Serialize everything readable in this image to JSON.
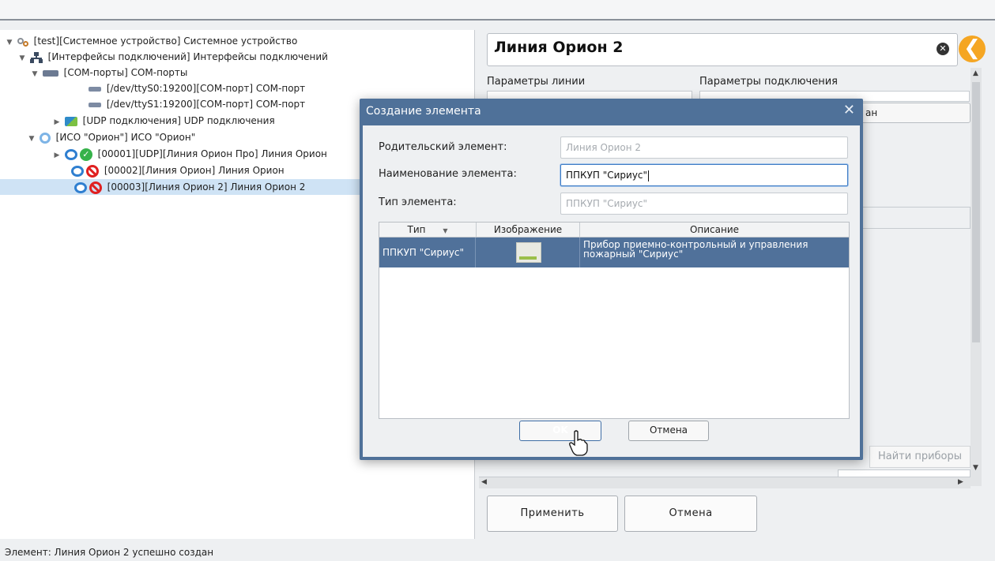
{
  "tree": {
    "items": [
      {
        "label": "[test][Системное устройство] Системное устройство"
      },
      {
        "label": "[Интерфейсы подключений] Интерфейсы подключений"
      },
      {
        "label": "[COM-порты] COM-порты"
      },
      {
        "label": "[/dev/ttyS0:19200][COM-порт] COM-порт"
      },
      {
        "label": "[/dev/ttyS1:19200][COM-порт] COM-порт"
      },
      {
        "label": "[UDP подключения] UDP подключения"
      },
      {
        "label": "[ИСО \"Орион\"] ИСО \"Орион\""
      },
      {
        "label": "[00001][UDP][Линия Орион Про] Линия Орион"
      },
      {
        "label": "[00002][Линия Орион] Линия Орион"
      },
      {
        "label": "[00003][Линия Орион 2] Линия Орион 2"
      }
    ]
  },
  "status": {
    "text": "Элемент: Линия Орион 2 успешно создан"
  },
  "right": {
    "title": "Линия Орион 2",
    "line_params_label": "Параметры линии",
    "conn_params_label": "Параметры подключения",
    "partial_button": "ан",
    "find_devices": "Найти приборы",
    "apply": "Применить",
    "cancel": "Отмена"
  },
  "dialog": {
    "title": "Создание элемента",
    "parent_label": "Родительский элемент:",
    "parent_value": "Линия Орион 2",
    "name_label": "Наименование элемента:",
    "name_value": "ППКУП \"Сириус\"",
    "type_label": "Тип элемента:",
    "type_value": "ППКУП \"Сириус\"",
    "table": {
      "columns": [
        "Тип",
        "Изображение",
        "Описание"
      ],
      "rows": [
        {
          "type": "ППКУП \"Сириус\"",
          "description": "Прибор приемно-контрольный и управления пожарный \"Сириус\""
        }
      ]
    },
    "ok": "OK",
    "cancel": "Отмена"
  }
}
